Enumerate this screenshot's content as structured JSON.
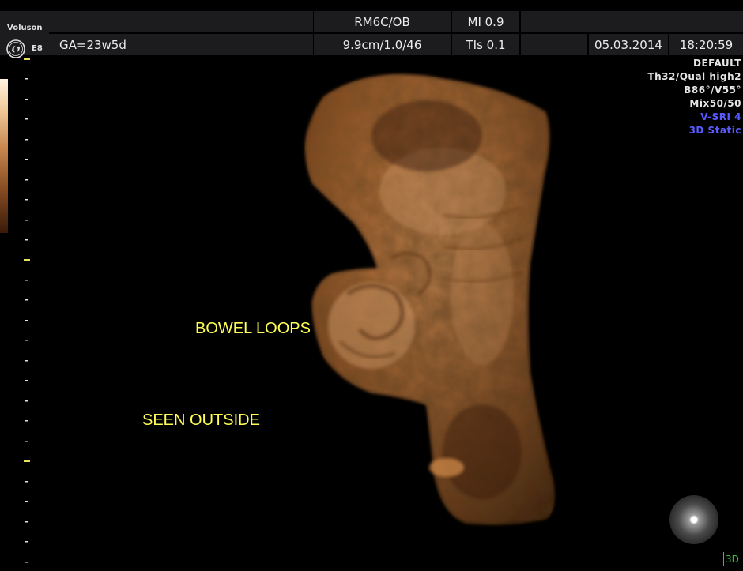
{
  "brand": "Voluson",
  "model": "E8",
  "logo_icon": "ge-logo-icon",
  "header": {
    "probe": "RM6C/OB",
    "mi": "MI 0.9",
    "gestational_age": "GA=23w5d",
    "depth": "9.9cm/1.0/46",
    "tis": "TIs 0.1",
    "date": "05.03.2014",
    "time": "18:20:59"
  },
  "settings": {
    "preset": "DEFAULT",
    "quality": "Th32/Qual high2",
    "angles": "B86°/V55°",
    "mix": "Mix50/50",
    "srI": "V-SRI 4",
    "mode": "3D Static"
  },
  "annotations": {
    "line1": "BOWEL LOOPS",
    "line2": "SEEN OUTSIDE"
  },
  "view_mode": "3D",
  "colors": {
    "annotation": "#ffff55",
    "mode_text": "#5a5aff",
    "render_tone": "#c67a3c"
  }
}
